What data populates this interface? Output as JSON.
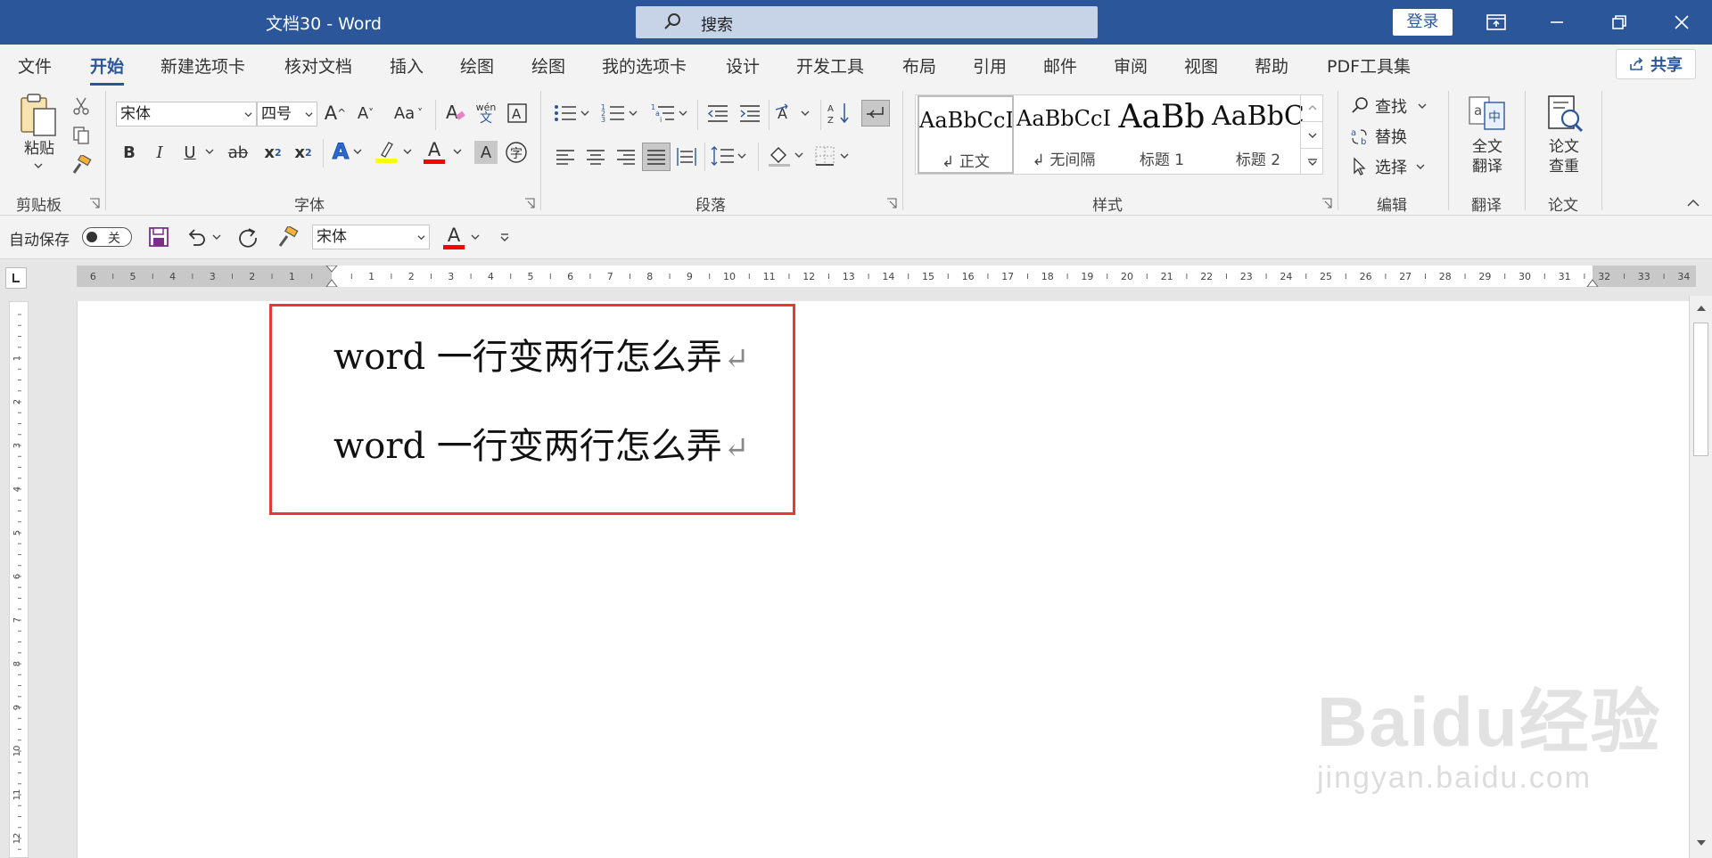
{
  "title_bar": {
    "doc_title": "文档30  -  Word",
    "search_placeholder": "搜索",
    "login_label": "登录"
  },
  "tabs": [
    "文件",
    "开始",
    "新建选项卡",
    "核对文档",
    "插入",
    "绘图",
    "绘图",
    "我的选项卡",
    "设计",
    "开发工具",
    "布局",
    "引用",
    "邮件",
    "审阅",
    "视图",
    "帮助",
    "PDF工具集"
  ],
  "active_tab": "开始",
  "share_label": "共享",
  "ribbon": {
    "clipboard": {
      "paste_label": "粘贴",
      "group": "剪贴板"
    },
    "font": {
      "font_name": "宋体",
      "font_size": "四号",
      "group": "字体",
      "wen_label": "wén",
      "wen_char": "文",
      "bold": "B",
      "italic": "I",
      "underline": "U",
      "strike": "ab",
      "subscript": "x",
      "superscript": "x",
      "case": "Aa",
      "grow": "A",
      "shrink": "A",
      "effects": "A",
      "color": "A",
      "shade": "A",
      "enclose": "字",
      "highlight_color": "#ffff00",
      "font_color": "#ff0000"
    },
    "paragraph": {
      "group": "段落"
    },
    "styles": {
      "group": "样式",
      "items": [
        {
          "preview": "AaBbCcI",
          "name": "↲ 正文"
        },
        {
          "preview": "AaBbCcI",
          "name": "↲ 无间隔"
        },
        {
          "preview": "AaBb",
          "name": "标题 1"
        },
        {
          "preview": "AaBbC",
          "name": "标题 2"
        }
      ]
    },
    "editing": {
      "find": "查找",
      "replace": "替换",
      "select": "选择",
      "group": "编辑"
    },
    "translate": {
      "label_line1": "全文",
      "label_line2": "翻译",
      "group": "翻译"
    },
    "paper": {
      "label_line1": "论文",
      "label_line2": "查重",
      "group": "论文"
    }
  },
  "qat": {
    "autosave_label": "自动保存",
    "autosave_state": "关",
    "font_name": "宋体"
  },
  "ruler": {
    "left_numbers": [
      "6",
      "5",
      "4",
      "3",
      "2",
      "1"
    ],
    "right_numbers": [
      "1",
      "2",
      "3",
      "4",
      "5",
      "6",
      "7",
      "8",
      "9",
      "10",
      "11",
      "12",
      "13",
      "14",
      "15",
      "16",
      "17",
      "18",
      "19",
      "20",
      "21",
      "22",
      "23",
      "24",
      "25",
      "26",
      "27",
      "28",
      "29",
      "30",
      "31",
      "32",
      "33",
      "34"
    ],
    "vertical_numbers": [
      "1",
      "2",
      "3",
      "4",
      "5",
      "6",
      "7",
      "8",
      "9",
      "10",
      "11",
      "12"
    ]
  },
  "document": {
    "lines": [
      "word 一行变两行怎么弄",
      "word 一行变两行怎么弄"
    ],
    "paragraph_mark": "↵",
    "highlight_box_color": "#e53935"
  },
  "watermark": {
    "line1": "Baidu经验",
    "line2": "jingyan.baidu.com"
  },
  "colors": {
    "brand": "#2b579a",
    "ribbon_bg": "#f3f3f3"
  }
}
